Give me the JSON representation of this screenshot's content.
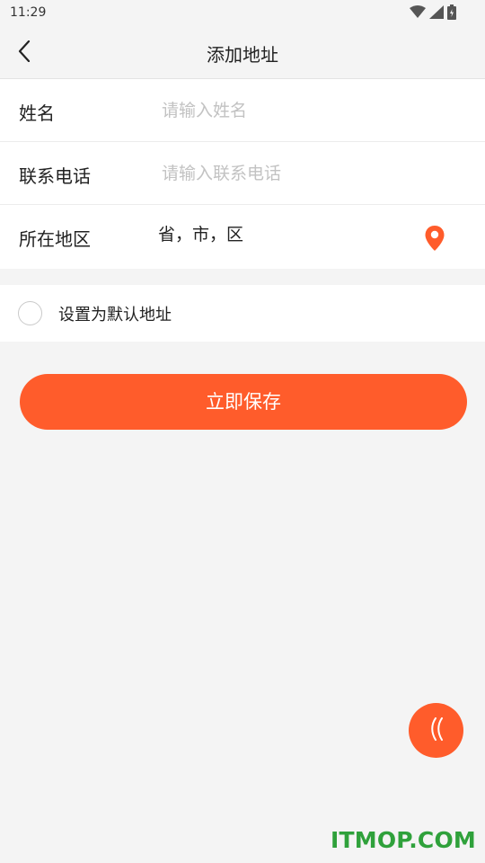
{
  "status_bar": {
    "time": "11:29",
    "icons": [
      "wifi-icon",
      "signal-icon",
      "battery-icon"
    ]
  },
  "header": {
    "title": "添加地址",
    "back_icon": "chevron-left-icon"
  },
  "form": {
    "name": {
      "label": "姓名",
      "value": "",
      "placeholder": "请输入姓名"
    },
    "phone": {
      "label": "联系电话",
      "value": "",
      "placeholder": "请输入联系电话"
    },
    "region": {
      "label": "所在地区",
      "value": "省，市，区",
      "icon": "location-pin-icon"
    }
  },
  "default_address": {
    "label": "设置为默认地址",
    "checked": false
  },
  "save_button": {
    "label": "立即保存"
  },
  "floating_button": {
    "icon": "double-chevron-left-icon"
  },
  "watermark": {
    "text": "ITMOP.COM"
  },
  "colors": {
    "accent": "#ff5c2b",
    "background": "#f4f4f4",
    "placeholder": "#c2c2c2",
    "watermark": "#2fa13b"
  }
}
